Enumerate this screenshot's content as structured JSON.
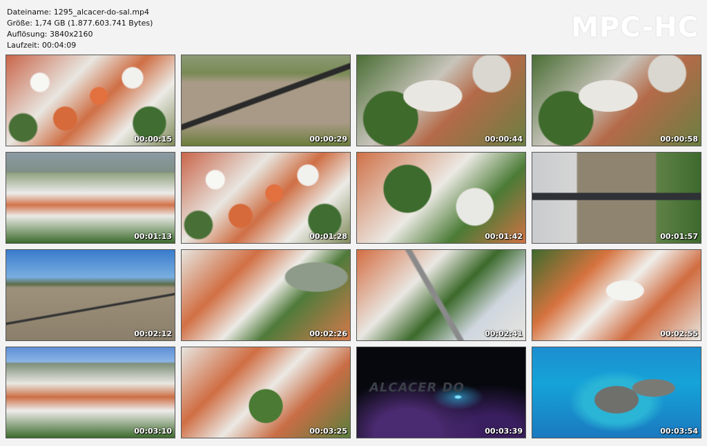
{
  "file_info": {
    "filename": "Dateiname: 1295_alcacer-do-sal.mp4",
    "size": "Größe: 1,74 GB (1.877.603.741 Bytes)",
    "resolution": "Auflösung: 3840x2160",
    "duration": "Laufzeit: 00:04:09"
  },
  "brand": "MPC-HC",
  "thumbnails": [
    {
      "time": "00:00:15"
    },
    {
      "time": "00:00:29"
    },
    {
      "time": "00:00:44"
    },
    {
      "time": "00:00:58"
    },
    {
      "time": "00:01:13"
    },
    {
      "time": "00:01:28"
    },
    {
      "time": "00:01:42"
    },
    {
      "time": "00:01:57"
    },
    {
      "time": "00:02:12"
    },
    {
      "time": "00:02:26"
    },
    {
      "time": "00:02:41"
    },
    {
      "time": "00:02:55"
    },
    {
      "time": "00:03:10"
    },
    {
      "time": "00:03:25"
    },
    {
      "time": "00:03:39",
      "overlay_text": "ALCACER DO"
    },
    {
      "time": "00:03:54"
    }
  ]
}
